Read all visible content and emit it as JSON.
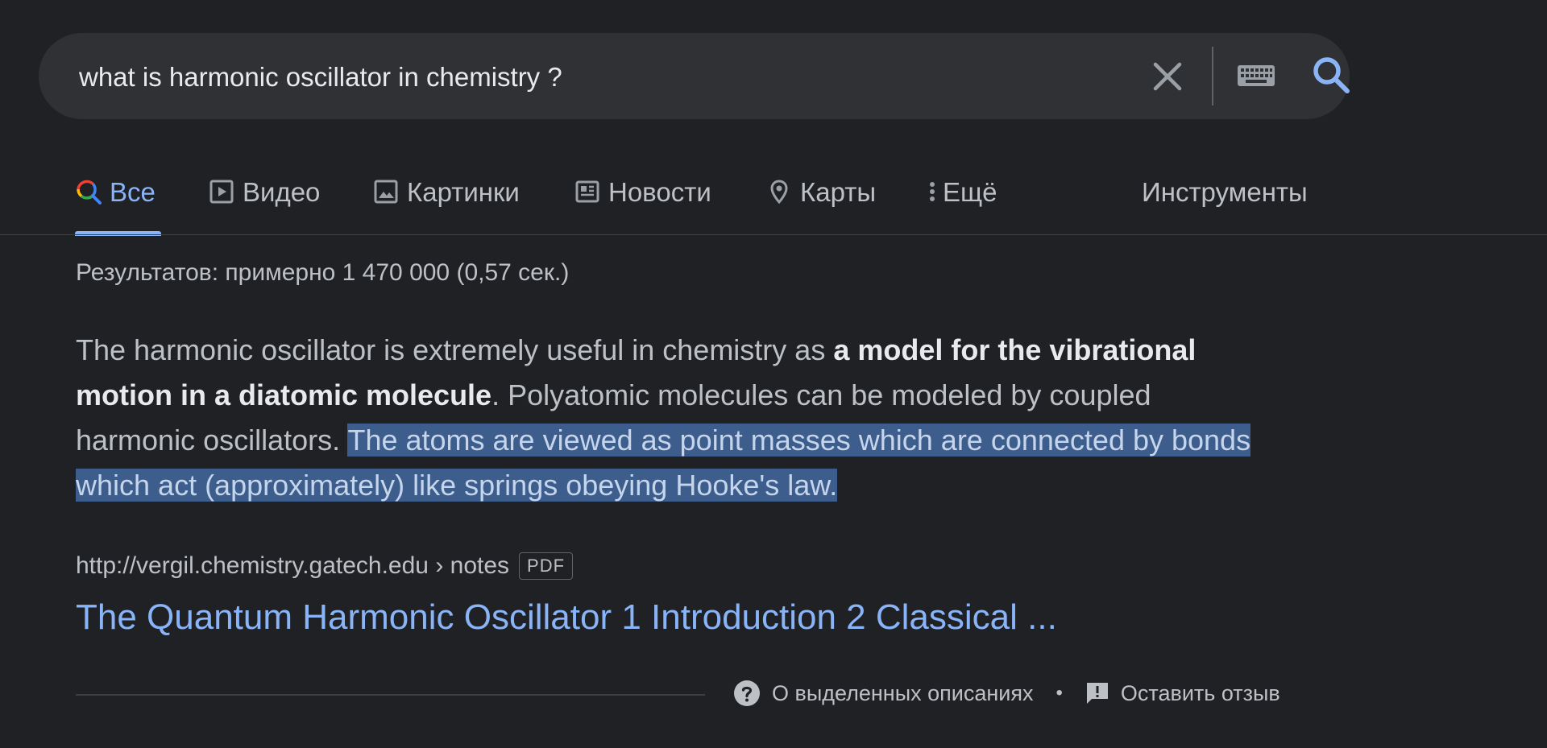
{
  "search": {
    "query": "what is harmonic oscillator in chemistry ?"
  },
  "tabs": [
    {
      "label": "Все",
      "icon": "google-search-icon",
      "active": true
    },
    {
      "label": "Видео",
      "icon": "video-icon"
    },
    {
      "label": "Картинки",
      "icon": "image-icon"
    },
    {
      "label": "Новости",
      "icon": "news-icon"
    },
    {
      "label": "Карты",
      "icon": "map-pin-icon"
    },
    {
      "label": "Ещё",
      "icon": "more-vert-icon"
    }
  ],
  "tools_label": "Инструменты",
  "result_stats": "Результатов: примерно 1 470 000 (0,57 сек.)",
  "snippet": {
    "part1": "The harmonic oscillator is extremely useful in chemistry as ",
    "bold": "a model for the vibrational motion in a diatomic molecule",
    "part2": ". Polyatomic molecules can be modeled by coupled harmonic oscillators. ",
    "highlighted": "The atoms are viewed as point masses which are connected by bonds which act (approximately) like springs obeying Hooke's law."
  },
  "source": {
    "url": "http://vergil.chemistry.gatech.edu › notes",
    "badge": "PDF"
  },
  "result_title": "The Quantum Harmonic Oscillator 1 Introduction 2 Classical ...",
  "footer": {
    "about_label": "О выделенных описаниях",
    "separator": "•",
    "feedback_label": "Оставить отзыв"
  },
  "colors": {
    "background": "#202124",
    "search_box": "#303134",
    "link_blue": "#8ab4f8",
    "text": "#bdc1c6",
    "highlight": "#3d5d8c"
  }
}
